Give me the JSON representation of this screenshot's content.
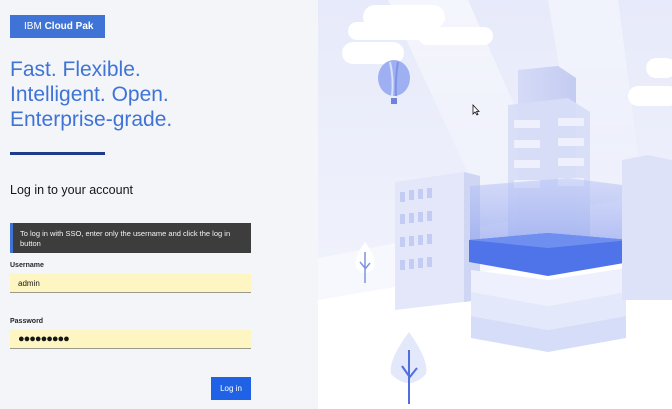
{
  "brand": {
    "prefix": "IBM",
    "product": "Cloud Pak"
  },
  "tagline": [
    "Fast. Flexible.",
    "Intelligent. Open.",
    "Enterprise-grade."
  ],
  "login": {
    "heading": "Log in to your account",
    "sso_notice": "To log in with SSO, enter only the username and click the log in button",
    "username_label": "Username",
    "username_value": "admin",
    "password_label": "Password",
    "password_masked": "●●●●●●●●●",
    "submit_label": "Log in"
  },
  "colors": {
    "brand_blue": "#3f74d6",
    "button_blue": "#1f62e6",
    "rule_navy": "#1d3c8c",
    "autofill_yellow": "#fdf6c2",
    "notice_dark": "#3d3d3d"
  },
  "icons": {
    "cursor": "mouse-pointer-icon"
  }
}
